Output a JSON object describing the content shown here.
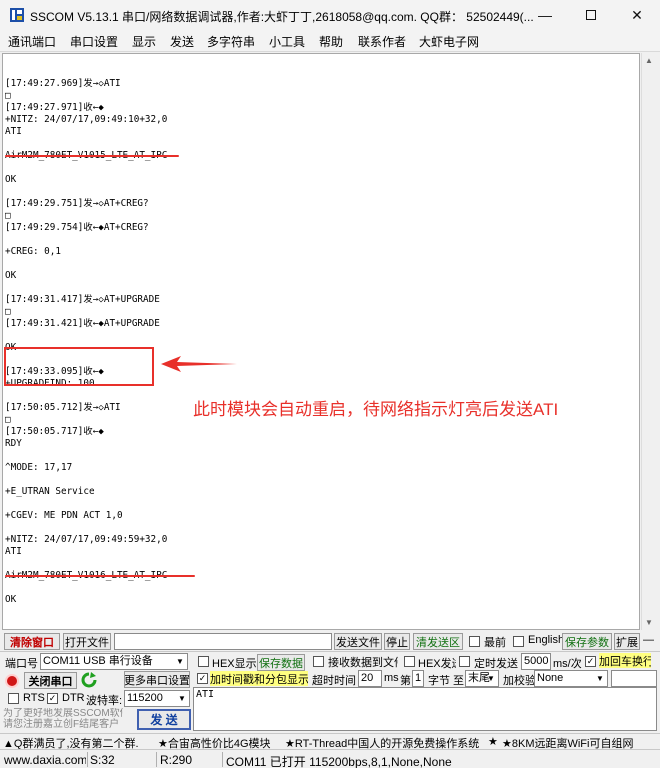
{
  "window": {
    "title": "SSCOM V5.13.1 串口/网络数据调试器,作者:大虾丁丁,2618058@qq.com. QQ群： 52502449(...",
    "minimize_icon": "minimize-icon",
    "maximize_icon": "maximize-icon",
    "close_icon": "close-icon"
  },
  "menu": [
    "通讯端口",
    "串口设置",
    "显示",
    "发送",
    "多字符串",
    "小工具",
    "帮助",
    "联系作者",
    "大虾电子网"
  ],
  "receive_log": "\n[17:49:27.969]发→◇ATI\n□\n[17:49:27.971]收←◆\n+NITZ: 24/07/17,09:49:10+32,0\nATI\n\nAirM2M_780ET_V1015_LTE_AT_IPC\n\nOK\n\n[17:49:29.751]发→◇AT+CREG?\n□\n[17:49:29.754]收←◆AT+CREG?\n\n+CREG: 0,1\n\nOK\n\n[17:49:31.417]发→◇AT+UPGRADE\n□\n[17:49:31.421]收←◆AT+UPGRADE\n\nOK\n\n[17:49:33.095]收←◆\n+UPGRADEIND: 100\n\n[17:50:05.712]发→◇ATI\n□\n[17:50:05.717]收←◆\nRDY\n\n^MODE: 17,17\n\n+E_UTRAN Service\n\n+CGEV: ME PDN ACT 1,0\n\n+NITZ: 24/07/17,09:49:59+32,0\nATI\n\nAirM2M_780ET_V1016_LTE_AT_IPC\n\nOK",
  "annotation": {
    "text": "此时模块会自动重启，待网络指示灯亮后发送ATI",
    "color": "#e8302a"
  },
  "row1": {
    "clear_window": "清除窗口",
    "open_file": "打开文件",
    "file_path": "",
    "send_file": "发送文件",
    "stop": "停止",
    "clear_send": "清发送区",
    "topmost": "最前",
    "english": "English",
    "save_params": "保存参数",
    "expand": "扩展",
    "hyphen": "—"
  },
  "port": {
    "label": "端口号",
    "value": "COM11 USB 串行设备",
    "close_port": "关闭串口",
    "more_settings": "更多串口设置",
    "rts": "RTS",
    "dtr": "DTR",
    "baud_label": "波特率:",
    "baud": "115200",
    "rts_checked": false,
    "dtr_checked": true
  },
  "display": {
    "hex_display": "HEX显示",
    "save_data": "保存数据",
    "recv_to_file": "接收数据到文件",
    "hex_send": "HEX发送",
    "timed_send": "定时发送",
    "interval": "5000",
    "interval_unit": "ms/次",
    "add_crlf": "加回车换行",
    "timestamp": "加时间戳和分包显示",
    "timeout_label": "超时时间",
    "timeout": "20",
    "ms": "ms",
    "byte_prefix": "第",
    "byte_num": "1",
    "byte_label": "字节 至",
    "byte_end": "末尾",
    "checksum_label": "加校验",
    "checksum": "None"
  },
  "send": {
    "text": "ATI",
    "button": "发  送",
    "promo": "为了更好地发展SSCOM软件\n请您注册嘉立创F结尾客户"
  },
  "ticker": {
    "items": [
      "▲Q群满员了,没有第二个群.",
      "★合宙高性价比4G模块",
      "★RT-Thread中国人的开源免费操作系统",
      "★",
      "★8KM远距离WiFi可自组网"
    ]
  },
  "statusbar": {
    "website": "www.daxia.com",
    "sent": "S:32",
    "received": "R:290",
    "port_status": "COM11 已打开  115200bps,8,1,None,None"
  }
}
